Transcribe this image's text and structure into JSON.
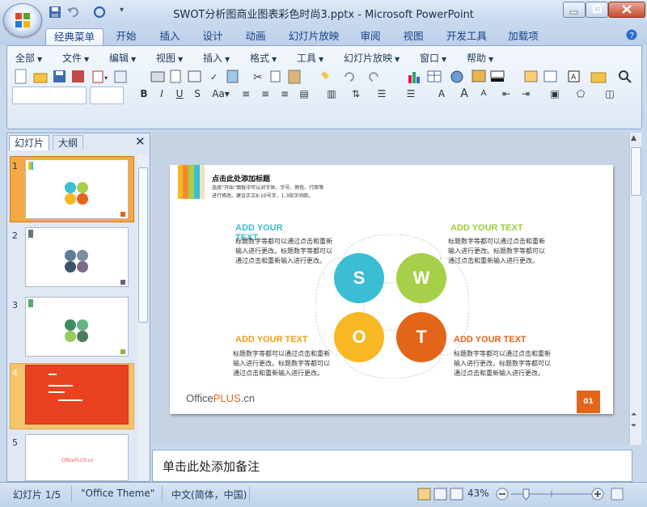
{
  "window": {
    "title": "SWOT分析图商业图表彩色时尚3.pptx - Microsoft PowerPoint"
  },
  "ribbon_tabs": [
    "经典菜单",
    "开始",
    "插入",
    "设计",
    "动画",
    "幻灯片放映",
    "审阅",
    "视图",
    "开发工具",
    "加载项"
  ],
  "classic_menu": [
    "全部",
    "文件",
    "编辑",
    "视图",
    "插入",
    "格式",
    "工具",
    "幻灯片放映",
    "窗口",
    "帮助"
  ],
  "left_pane": {
    "tabs": [
      "幻灯片",
      "大纲"
    ],
    "slide_numbers": [
      "1",
      "2",
      "3",
      "4",
      "5"
    ]
  },
  "slide": {
    "title": "点击此处添加标题",
    "subtitle_lines": [
      "选择“开始”面板中可以对字体、字号、颜色、行距等",
      "进行修改。建议正文8-10号字，1.3倍字间距。"
    ],
    "heading_tl": "ADD YOUR TEXT",
    "heading_tr": "ADD YOUR TEXT",
    "heading_bl": "ADD YOUR TEXT",
    "heading_br": "ADD YOUR TEXT",
    "body_lines": [
      "标题数字等都可以通过点击和重新",
      "输入进行更改。标题数字等都可以",
      "通过点击和重新输入进行更改。"
    ],
    "circles": [
      "S",
      "W",
      "O",
      "T"
    ],
    "brand_office": "Office",
    "brand_plus": "PLUS",
    "brand_cn": ".cn",
    "page_number": "01",
    "colors": {
      "S": "#3bbdd4",
      "W": "#a6cf4a",
      "O": "#f7b823",
      "T": "#e3651a",
      "heading_green": "#9bcb3c",
      "heading_orange": "#f0a014"
    }
  },
  "notes_placeholder": "单击此处添加备注",
  "status": {
    "slide_indicator": "幻灯片 1/5",
    "theme": "\"Office Theme\"",
    "language": "中文(简体，中国)",
    "zoom": "43%"
  }
}
